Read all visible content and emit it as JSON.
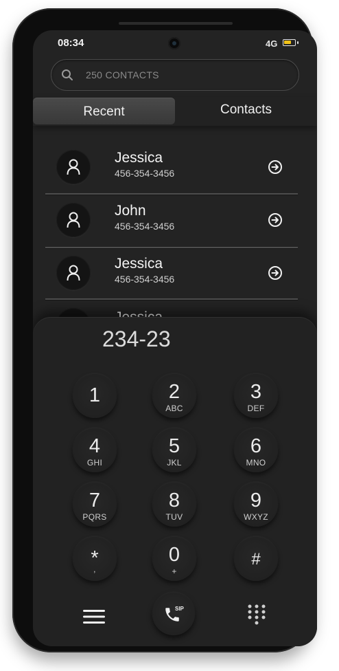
{
  "status_bar": {
    "time": "08:34",
    "network": "4G",
    "battery_level": 0.75,
    "battery_color": "#f2c318"
  },
  "search": {
    "placeholder": "250 CONTACTS"
  },
  "tabs": [
    {
      "label": "Recent",
      "active": true
    },
    {
      "label": "Contacts",
      "active": false
    }
  ],
  "contacts": [
    {
      "name": "Jessica",
      "phone": "456-354-3456"
    },
    {
      "name": "John",
      "phone": "456-354-3456"
    },
    {
      "name": "Jessica",
      "phone": "456-354-3456"
    }
  ],
  "dialer": {
    "number": "234-23",
    "keys": [
      {
        "digit": "1",
        "letters": ""
      },
      {
        "digit": "2",
        "letters": "ABC"
      },
      {
        "digit": "3",
        "letters": "DEF"
      },
      {
        "digit": "4",
        "letters": "GHI"
      },
      {
        "digit": "5",
        "letters": "JKL"
      },
      {
        "digit": "6",
        "letters": "MNO"
      },
      {
        "digit": "7",
        "letters": "PQRS"
      },
      {
        "digit": "8",
        "letters": "TUV"
      },
      {
        "digit": "9",
        "letters": "WXYZ"
      },
      {
        "digit": "*",
        "letters": ","
      },
      {
        "digit": "0",
        "letters": "+"
      },
      {
        "digit": "#",
        "letters": ""
      }
    ],
    "call_badge": "SIP",
    "icons": {
      "menu": "hamburger-menu-icon",
      "call": "phone-icon",
      "keypad": "dialpad-grid-icon"
    }
  }
}
